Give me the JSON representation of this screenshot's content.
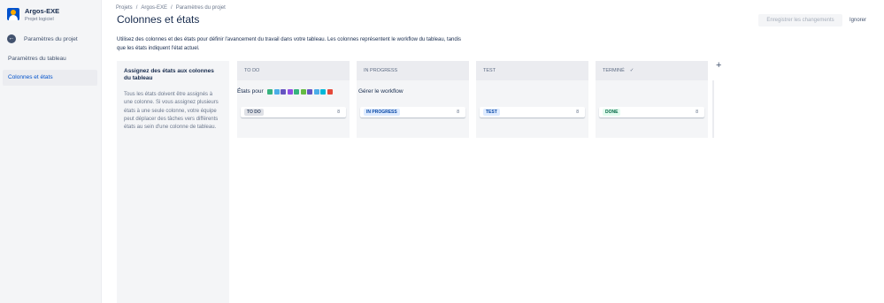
{
  "sidebar": {
    "project_name": "Argos-EXE",
    "project_type": "Projet logiciel",
    "back_label": "Paramètres du projet",
    "items": [
      {
        "label": "Paramètres du tableau"
      },
      {
        "label": "Colonnes et états"
      }
    ],
    "active_index": 1
  },
  "header": {
    "breadcrumb": [
      "Projets",
      "Argos-EXE",
      "Paramètres du projet"
    ],
    "title": "Colonnes et états",
    "save_label": "Enregistrer les changements",
    "cancel_label": "Ignorer"
  },
  "main": {
    "description": "Utilisez des colonnes et des états pour définir l'avancement du travail dans votre tableau. Les colonnes représentent le workflow du tableau, tandis que les états indiquent l'état actuel.",
    "info_title": "Assignez des états aux colonnes du tableau",
    "info_text": "Tous les états doivent être assignés à une colonne. Si vous assignez plusieurs états à une seule colonne, votre équipe peut déplacer des tâches vers différents états au sein d'une colonne de tableau.",
    "states_label": "États pour",
    "manage_workflow": "Gérer le workflow",
    "issue_type_icons": [
      {
        "name": "story-icon",
        "color": "#36b37e"
      },
      {
        "name": "task-icon",
        "color": "#4bade8"
      },
      {
        "name": "subtask-icon",
        "color": "#6554c0"
      },
      {
        "name": "epic-icon",
        "color": "#904ee2"
      },
      {
        "name": "improvement-icon",
        "color": "#36b37e"
      },
      {
        "name": "new-feature-icon",
        "color": "#65ba43"
      },
      {
        "name": "issue-icon",
        "color": "#6554c0"
      },
      {
        "name": "change-icon",
        "color": "#4bade8"
      },
      {
        "name": "question-icon",
        "color": "#00b8d9"
      },
      {
        "name": "bug-icon",
        "color": "#e5493a"
      }
    ],
    "columns": [
      {
        "header": "TO DO",
        "status": "TO DO",
        "count": "8",
        "done": false
      },
      {
        "header": "IN PROGRESS",
        "status": "IN PROGRESS",
        "count": "8",
        "done": false
      },
      {
        "header": "TEST",
        "status": "TEST",
        "count": "8",
        "done": false
      },
      {
        "header": "TERMINÉ",
        "status": "DONE",
        "count": "8",
        "done": true
      }
    ],
    "add_column_icon": "plus-icon"
  }
}
